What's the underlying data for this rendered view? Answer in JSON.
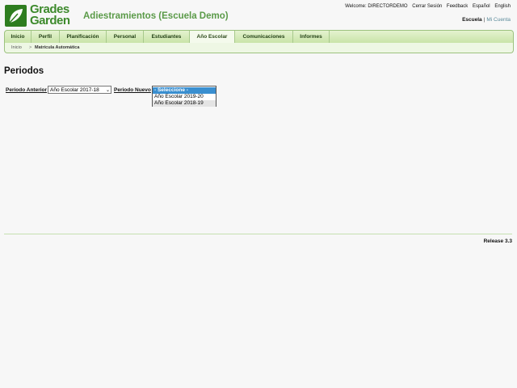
{
  "logo": {
    "line1": "Grades",
    "line2": "Garden"
  },
  "app_title": "Adiestramientos (Escuela Demo)",
  "top_links": [
    "Welcome: DIRECTORDEMO",
    "Cerrar Sesión",
    "Feedback",
    "Español",
    "English"
  ],
  "school_links": {
    "active": "Escuela",
    "separator": "|",
    "other": "Mi Cuenta"
  },
  "nav": [
    "Inicio",
    "Perfil",
    "Planificación",
    "Personal",
    "Estudiantes",
    "Año Escolar",
    "Comunicaciones",
    "Informes"
  ],
  "breadcrumb": {
    "home": "Inicio",
    "separator": ">",
    "current": "Matrícula Automática"
  },
  "page_title": "Periodos",
  "form": {
    "prev_label": "Periodo Anterior",
    "prev_value": "Año Escolar 2017-18",
    "new_label": "Periodo Nuevo",
    "dropdown_options": [
      "- Seleccione -",
      "Año Escolar 2019-20",
      "Año Escolar 2018-19"
    ]
  },
  "release": "Release 3.3"
}
